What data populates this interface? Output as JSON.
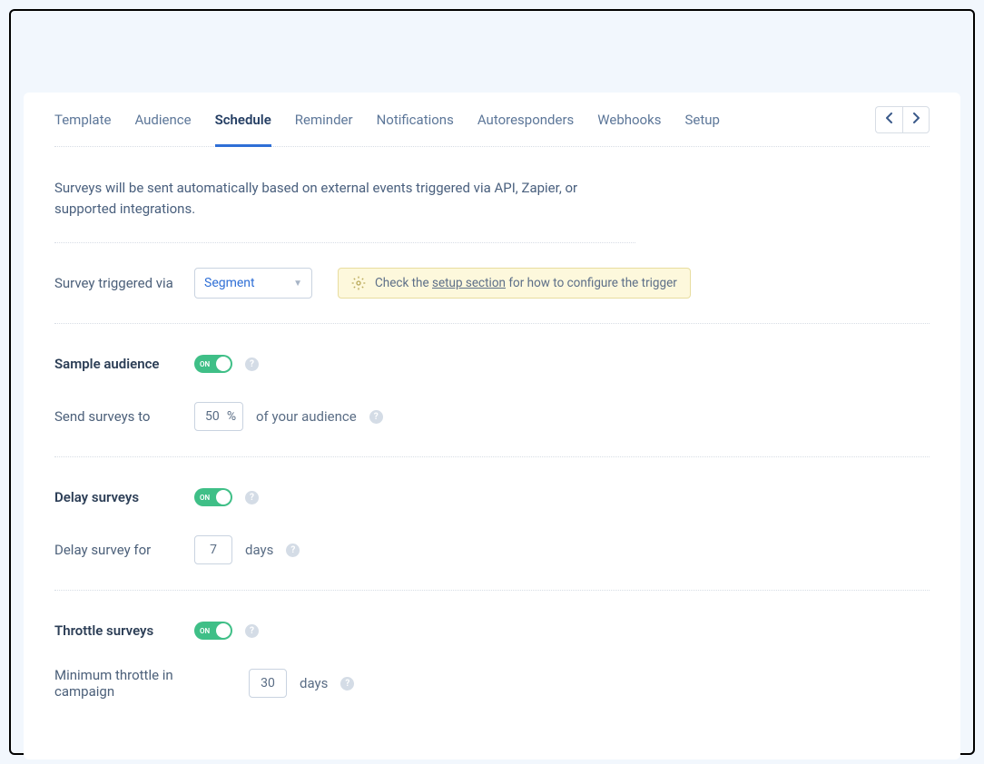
{
  "tabs": [
    {
      "label": "Template"
    },
    {
      "label": "Audience"
    },
    {
      "label": "Schedule"
    },
    {
      "label": "Reminder"
    },
    {
      "label": "Notifications"
    },
    {
      "label": "Autoresponders"
    },
    {
      "label": "Webhooks"
    },
    {
      "label": "Setup"
    }
  ],
  "activeTab": 2,
  "description": "Surveys will be sent automatically based on external events triggered via API, Zapier, or supported integrations.",
  "trigger": {
    "label": "Survey triggered via",
    "value": "Segment",
    "callout_pre": "Check the",
    "callout_link": "setup section",
    "callout_post": "for how to configure the trigger"
  },
  "sample": {
    "title": "Sample audience",
    "toggle_text": "ON",
    "send_label": "Send surveys to",
    "value": "50",
    "unit": "%",
    "suffix": "of your audience"
  },
  "delay": {
    "title": "Delay surveys",
    "toggle_text": "ON",
    "label": "Delay survey for",
    "value": "7",
    "unit": "days"
  },
  "throttle": {
    "title": "Throttle surveys",
    "toggle_text": "ON",
    "label": "Minimum throttle in campaign",
    "value": "30",
    "unit": "days"
  }
}
